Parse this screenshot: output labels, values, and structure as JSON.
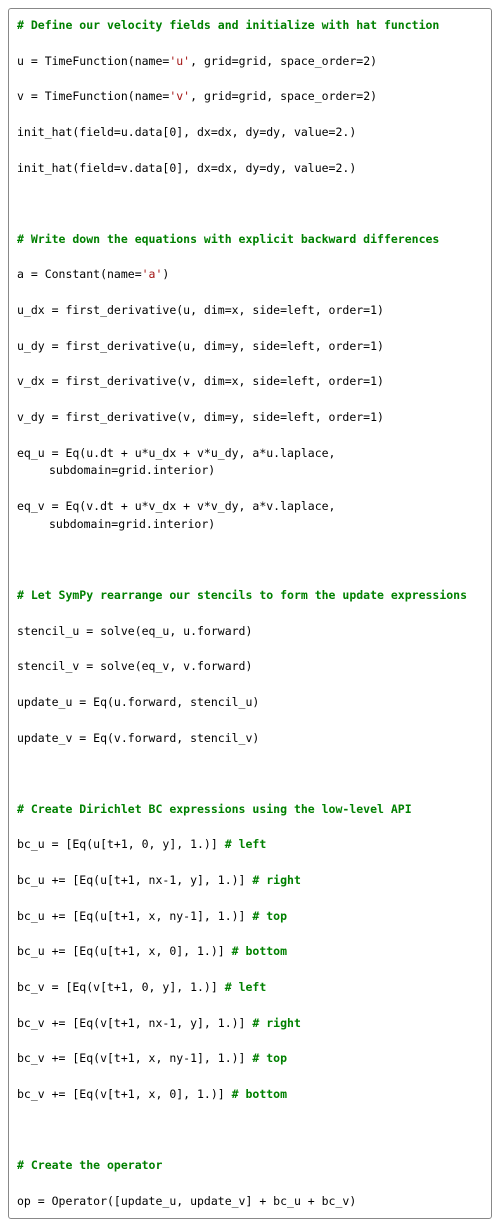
{
  "lines": [
    {
      "cls": "line",
      "spans": [
        {
          "cls": "c",
          "t": "# Define our velocity fields and initialize with hat function"
        }
      ]
    },
    {
      "cls": "line",
      "spans": [
        {
          "cls": "k",
          "t": "u = TimeFunction(name="
        },
        {
          "cls": "s",
          "t": "'u'"
        },
        {
          "cls": "k",
          "t": ", grid=grid, space_order=2)"
        }
      ]
    },
    {
      "cls": "line",
      "spans": [
        {
          "cls": "k",
          "t": "v = TimeFunction(name="
        },
        {
          "cls": "s",
          "t": "'v'"
        },
        {
          "cls": "k",
          "t": ", grid=grid, space_order=2)"
        }
      ]
    },
    {
      "cls": "line",
      "spans": [
        {
          "cls": "k",
          "t": "init_hat(field=u.data[0], dx=dx, dy=dy, value=2.)"
        }
      ]
    },
    {
      "cls": "line",
      "spans": [
        {
          "cls": "k",
          "t": "init_hat(field=v.data[0], dx=dx, dy=dy, value=2.)"
        }
      ]
    },
    {
      "cls": "line",
      "spans": [
        {
          "cls": "k",
          "t": " "
        }
      ]
    },
    {
      "cls": "line",
      "spans": [
        {
          "cls": "c",
          "t": "# Write down the equations with explicit backward differences"
        }
      ]
    },
    {
      "cls": "line",
      "spans": [
        {
          "cls": "k",
          "t": "a = Constant(name="
        },
        {
          "cls": "s",
          "t": "'a'"
        },
        {
          "cls": "k",
          "t": ")"
        }
      ]
    },
    {
      "cls": "line",
      "spans": [
        {
          "cls": "k",
          "t": "u_dx = first_derivative(u, dim=x, side=left, order=1)"
        }
      ]
    },
    {
      "cls": "line",
      "spans": [
        {
          "cls": "k",
          "t": "u_dy = first_derivative(u, dim=y, side=left, order=1)"
        }
      ]
    },
    {
      "cls": "line",
      "spans": [
        {
          "cls": "k",
          "t": "v_dx = first_derivative(v, dim=x, side=left, order=1)"
        }
      ]
    },
    {
      "cls": "line",
      "spans": [
        {
          "cls": "k",
          "t": "v_dy = first_derivative(v, dim=y, side=left, order=1)"
        }
      ]
    },
    {
      "cls": "line",
      "spans": [
        {
          "cls": "k",
          "t": "eq_u = Eq(u.dt + u*u_dx + v*u_dy, a*u.laplace, subdomain=grid.interior)"
        }
      ]
    },
    {
      "cls": "line",
      "spans": [
        {
          "cls": "k",
          "t": "eq_v = Eq(v.dt + u*v_dx + v*v_dy, a*v.laplace, subdomain=grid.interior)"
        }
      ]
    },
    {
      "cls": "line",
      "spans": [
        {
          "cls": "k",
          "t": " "
        }
      ]
    },
    {
      "cls": "line",
      "spans": [
        {
          "cls": "c",
          "t": "# Let SymPy rearrange our stencils to form the update expressions"
        }
      ]
    },
    {
      "cls": "line",
      "spans": [
        {
          "cls": "k",
          "t": "stencil_u = solve(eq_u, u.forward)"
        }
      ]
    },
    {
      "cls": "line",
      "spans": [
        {
          "cls": "k",
          "t": "stencil_v = solve(eq_v, v.forward)"
        }
      ]
    },
    {
      "cls": "line",
      "spans": [
        {
          "cls": "k",
          "t": "update_u = Eq(u.forward, stencil_u)"
        }
      ]
    },
    {
      "cls": "line",
      "spans": [
        {
          "cls": "k",
          "t": "update_v = Eq(v.forward, stencil_v)"
        }
      ]
    },
    {
      "cls": "line",
      "spans": [
        {
          "cls": "k",
          "t": " "
        }
      ]
    },
    {
      "cls": "line",
      "spans": [
        {
          "cls": "c",
          "t": "# Create Dirichlet BC expressions using the low-level API"
        }
      ]
    },
    {
      "cls": "line",
      "spans": [
        {
          "cls": "k",
          "t": "bc_u = [Eq(u[t+1, 0, y], 1.)] "
        },
        {
          "cls": "c",
          "t": "# left"
        }
      ]
    },
    {
      "cls": "line",
      "spans": [
        {
          "cls": "k",
          "t": "bc_u += [Eq(u[t+1, nx-1, y], 1.)] "
        },
        {
          "cls": "c",
          "t": "# right"
        }
      ]
    },
    {
      "cls": "line",
      "spans": [
        {
          "cls": "k",
          "t": "bc_u += [Eq(u[t+1, x, ny-1], 1.)] "
        },
        {
          "cls": "c",
          "t": "# top"
        }
      ]
    },
    {
      "cls": "line",
      "spans": [
        {
          "cls": "k",
          "t": "bc_u += [Eq(u[t+1, x, 0], 1.)] "
        },
        {
          "cls": "c",
          "t": "# bottom"
        }
      ]
    },
    {
      "cls": "line",
      "spans": [
        {
          "cls": "k",
          "t": "bc_v = [Eq(v[t+1, 0, y], 1.)] "
        },
        {
          "cls": "c",
          "t": "# left"
        }
      ]
    },
    {
      "cls": "line",
      "spans": [
        {
          "cls": "k",
          "t": "bc_v += [Eq(v[t+1, nx-1, y], 1.)] "
        },
        {
          "cls": "c",
          "t": "# right"
        }
      ]
    },
    {
      "cls": "line",
      "spans": [
        {
          "cls": "k",
          "t": "bc_v += [Eq(v[t+1, x, ny-1], 1.)] "
        },
        {
          "cls": "c",
          "t": "# top"
        }
      ]
    },
    {
      "cls": "line",
      "spans": [
        {
          "cls": "k",
          "t": "bc_v += [Eq(v[t+1, x, 0], 1.)] "
        },
        {
          "cls": "c",
          "t": "# bottom"
        }
      ]
    },
    {
      "cls": "line",
      "spans": [
        {
          "cls": "k",
          "t": " "
        }
      ]
    },
    {
      "cls": "line",
      "spans": [
        {
          "cls": "c",
          "t": "# Create the operator"
        }
      ]
    },
    {
      "cls": "line",
      "spans": [
        {
          "cls": "k",
          "t": "op = Operator([update_u, update_v] + bc_u + bc_v)"
        }
      ]
    }
  ],
  "chart_data": null
}
